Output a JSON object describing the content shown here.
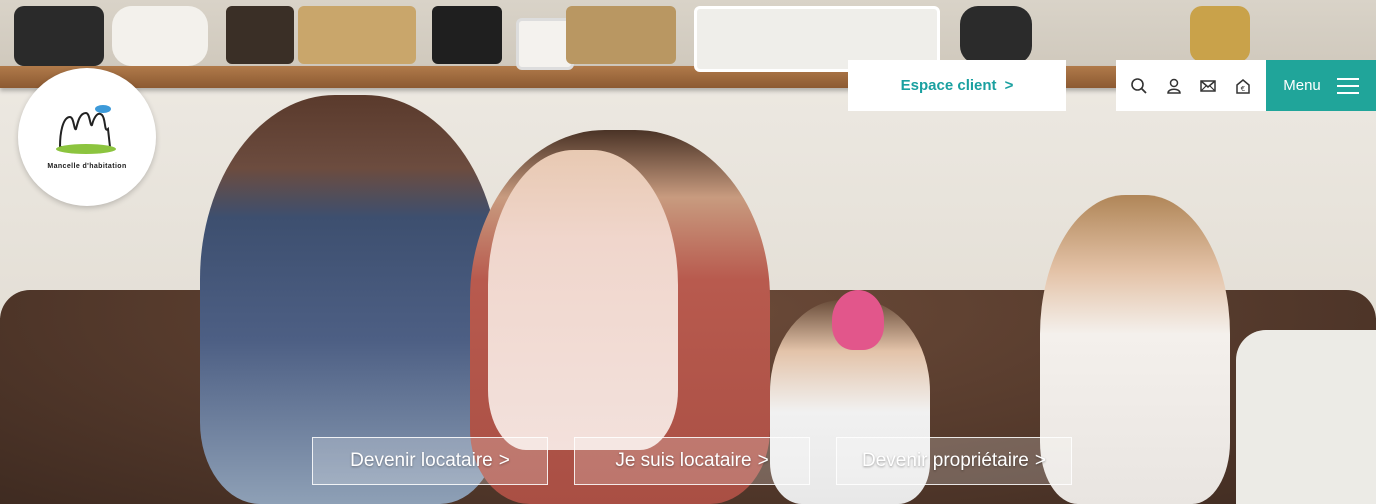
{
  "logo": {
    "text": "Mancelle d'habitation"
  },
  "header": {
    "espace_client": "Espace client",
    "espace_client_arrow": ">",
    "menu_label": "Menu",
    "icons": [
      "search-icon",
      "user-icon",
      "mail-icon",
      "home-euro-icon"
    ]
  },
  "cta": [
    {
      "label": "Devenir locataire",
      "arrow": ">"
    },
    {
      "label": "Je suis locataire",
      "arrow": ">"
    },
    {
      "label": "Devenir propriétaire",
      "arrow": ">"
    }
  ],
  "colors": {
    "accent": "#20a59a",
    "accent_text": "#1aa0a0"
  }
}
